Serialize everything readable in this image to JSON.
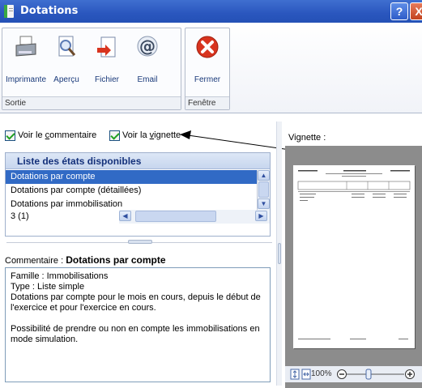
{
  "window": {
    "title": "Dotations",
    "help_symbol": "?",
    "close_symbol": "X"
  },
  "ribbon": {
    "groups": [
      {
        "label": "Sortie",
        "buttons": [
          {
            "label": "Imprimante",
            "icon": "printer-icon"
          },
          {
            "label": "Aperçu",
            "icon": "preview-icon"
          },
          {
            "label": "Fichier",
            "icon": "file-icon"
          },
          {
            "label": "Email",
            "icon": "email-icon"
          }
        ]
      },
      {
        "label": "Fenêtre",
        "buttons": [
          {
            "label": "Fermer",
            "icon": "close-icon"
          }
        ]
      }
    ]
  },
  "options": {
    "show_comment": {
      "prefix": "Voir le ",
      "accel": "c",
      "suffix": "ommentaire",
      "checked": true
    },
    "show_thumbnail": {
      "prefix": "Voir la ",
      "accel": "v",
      "suffix": "ignette",
      "checked": true
    }
  },
  "list": {
    "header": "Liste des états disponibles",
    "items": [
      "Dotations par compte",
      "Dotations par compte (détaillées)",
      "Dotations par immobilisation"
    ],
    "selected_index": 0,
    "count": "3 (1)"
  },
  "comment": {
    "label": "Commentaire :",
    "title": "Dotations par compte",
    "lines": [
      "Famille : Immobilisations",
      "Type : Liste simple",
      "Dotations par compte pour le mois en cours, depuis le début de l'exercice et pour l'exercice en cours.",
      "",
      "Possibilité de prendre ou non en compte les immobilisations en mode simulation."
    ]
  },
  "preview": {
    "label": "Vignette :",
    "zoom": "100%"
  },
  "colors": {
    "accent": "#2a56be",
    "selection": "#316ac5",
    "close_red": "#d8341f"
  }
}
